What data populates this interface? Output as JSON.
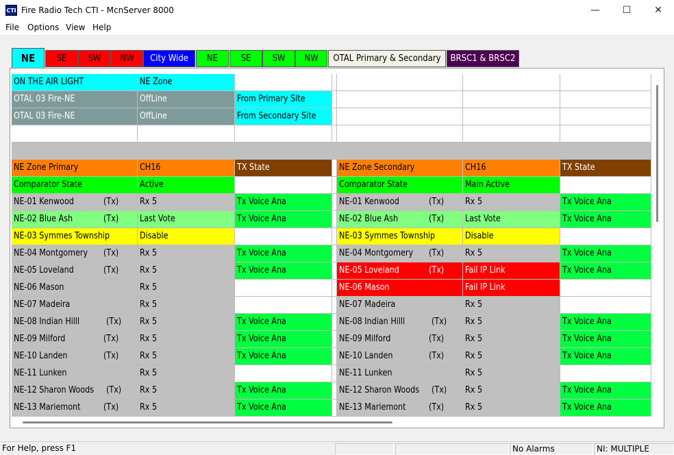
{
  "window": {
    "title": "Fire Radio Tech CTI - McnServer 8000",
    "icon_text": "CTI",
    "controls": {
      "minimize": "—",
      "maximize": "☐",
      "close": "✕"
    }
  },
  "menu": [
    "File",
    "Options",
    "View",
    "Help"
  ],
  "tabs": [
    {
      "label": "NE",
      "bg": "#00ffff",
      "fg": "#000000",
      "active": true
    },
    {
      "label": "SE",
      "bg": "#ff0000",
      "fg": "#000000"
    },
    {
      "label": "SW",
      "bg": "#ff0000",
      "fg": "#000000"
    },
    {
      "label": "NW",
      "bg": "#ff0000",
      "fg": "#000000"
    },
    {
      "label": "City Wide",
      "bg": "#0000ff",
      "fg": "#ffffff"
    },
    {
      "label": "NE",
      "bg": "#00ff00",
      "fg": "#000000"
    },
    {
      "label": "SE",
      "bg": "#00ff00",
      "fg": "#000000"
    },
    {
      "label": "SW",
      "bg": "#00ff00",
      "fg": "#000000"
    },
    {
      "label": "NW",
      "bg": "#00ff00",
      "fg": "#000000"
    },
    {
      "label": "OTAL Primary & Secondary",
      "bg": "#f2f2e6",
      "fg": "#000000"
    },
    {
      "label": "BRSC1 & BRSC2",
      "bg": "#4c0050",
      "fg": "#ffffff"
    }
  ],
  "colors": {
    "cyan": "#00ffff",
    "gray_teal": "#7f9a9a",
    "gray": "#c0c0c0",
    "orange": "#ff8000",
    "brown": "#7f4000",
    "green": "#00ff40",
    "light_green": "#80ff80",
    "yellow": "#ffff00",
    "red": "#ff0000",
    "white": "#ffffff"
  },
  "top_rows": [
    [
      {
        "text": "ON THE AIR LIGHT",
        "bg": "#00ffff"
      },
      {
        "text": "NE Zone",
        "bg": "#00ffff"
      },
      {
        "text": "",
        "bg": "#ffffff"
      }
    ],
    [
      {
        "text": "OTAL 03 Fire-NE",
        "bg": "#7f9a9a",
        "fg": "#ffffff"
      },
      {
        "text": "OffLine",
        "bg": "#7f9a9a",
        "fg": "#ffffff"
      },
      {
        "text": "From Primary Site",
        "bg": "#00ffff"
      }
    ],
    [
      {
        "text": "OTAL 03 Fire-NE",
        "bg": "#7f9a9a",
        "fg": "#ffffff"
      },
      {
        "text": "OffLine",
        "bg": "#7f9a9a",
        "fg": "#ffffff"
      },
      {
        "text": "From Secondary Site",
        "bg": "#00ffff"
      }
    ],
    [
      {
        "text": "",
        "bg": "#ffffff"
      },
      {
        "text": "",
        "bg": "#ffffff"
      },
      {
        "text": "",
        "bg": "#ffffff"
      }
    ]
  ],
  "primary": {
    "header": [
      {
        "text": "NE Zone Primary",
        "bg": "#ff8000"
      },
      {
        "text": "CH16",
        "bg": "#ff8000"
      },
      {
        "text": "TX State",
        "bg": "#7f4000",
        "fg": "#ffffff"
      }
    ],
    "comparator": [
      {
        "text": "Comparator State",
        "bg": "#00ff00"
      },
      {
        "text": "Active",
        "bg": "#00ff00"
      },
      {
        "text": "",
        "bg": "#ffffff"
      }
    ],
    "rows": [
      {
        "site": "NE-01 Kenwood",
        "tx": "(Tx)",
        "status": "Rx 5",
        "state": "Tx Voice Ana",
        "row_bg": "#c0c0c0",
        "state_bg": "#00ff40"
      },
      {
        "site": "NE-02 Blue Ash",
        "tx": "(Tx)",
        "status": "Last Vote",
        "state": "Tx Voice Ana",
        "row_bg": "#80ff80",
        "state_bg": "#00ff40"
      },
      {
        "site": "NE-03 Symmes Township",
        "tx": "",
        "status": "Disable",
        "state": "",
        "row_bg": "#ffff00",
        "state_bg": "#ffffff"
      },
      {
        "site": "NE-04 Montgomery",
        "tx": "(Tx)",
        "status": "Rx 5",
        "state": "Tx Voice Ana",
        "row_bg": "#c0c0c0",
        "state_bg": "#00ff40"
      },
      {
        "site": "NE-05 Loveland",
        "tx": "(Tx)",
        "status": "Rx 5",
        "state": "Tx Voice Ana",
        "row_bg": "#c0c0c0",
        "state_bg": "#00ff40"
      },
      {
        "site": "NE-06 Mason",
        "tx": "",
        "status": "Rx 5",
        "state": "",
        "row_bg": "#c0c0c0",
        "state_bg": "#ffffff"
      },
      {
        "site": "NE-07 Madeira",
        "tx": "",
        "status": "Rx 5",
        "state": "",
        "row_bg": "#c0c0c0",
        "state_bg": "#ffffff"
      },
      {
        "site": "NE-08 Indian Hilll",
        "tx": "(Tx)",
        "status": "Rx 5",
        "state": "Tx Voice Ana",
        "row_bg": "#c0c0c0",
        "state_bg": "#00ff40"
      },
      {
        "site": "NE-09 Milford",
        "tx": "(Tx)",
        "status": "Rx 5",
        "state": "Tx Voice Ana",
        "row_bg": "#c0c0c0",
        "state_bg": "#00ff40"
      },
      {
        "site": "NE-10 Landen",
        "tx": "(Tx)",
        "status": "Rx 5",
        "state": "Tx Voice Ana",
        "row_bg": "#c0c0c0",
        "state_bg": "#00ff40"
      },
      {
        "site": "NE-11 Lunken",
        "tx": "",
        "status": "Rx 5",
        "state": "",
        "row_bg": "#c0c0c0",
        "state_bg": "#ffffff"
      },
      {
        "site": "NE-12 Sharon Woods",
        "tx": "(Tx)",
        "status": "Rx 5",
        "state": "Tx Voice Ana",
        "row_bg": "#c0c0c0",
        "state_bg": "#00ff40"
      },
      {
        "site": "NE-13 Mariemont",
        "tx": "(Tx)",
        "status": "Rx 5",
        "state": "Tx Voice Ana",
        "row_bg": "#c0c0c0",
        "state_bg": "#00ff40"
      }
    ]
  },
  "secondary": {
    "header": [
      {
        "text": "NE Zone Secondary",
        "bg": "#ff8000"
      },
      {
        "text": "CH16",
        "bg": "#ff8000"
      },
      {
        "text": "TX State",
        "bg": "#7f4000",
        "fg": "#ffffff"
      }
    ],
    "comparator": [
      {
        "text": "Comparator State",
        "bg": "#00ff00"
      },
      {
        "text": "Main Active",
        "bg": "#00ff00"
      },
      {
        "text": "",
        "bg": "#ffffff"
      }
    ],
    "rows": [
      {
        "site": "NE-01 Kenwood",
        "tx": "(Tx)",
        "status": "Rx 5",
        "state": "Tx Voice Ana",
        "row_bg": "#c0c0c0",
        "state_bg": "#00ff40"
      },
      {
        "site": "NE-02 Blue Ash",
        "tx": "(Tx)",
        "status": "Last Vote",
        "state": "Tx Voice Ana",
        "row_bg": "#80ff80",
        "state_bg": "#00ff40"
      },
      {
        "site": "NE-03 Symmes Township",
        "tx": "",
        "status": "Disable",
        "state": "",
        "row_bg": "#ffff00",
        "state_bg": "#ffffff"
      },
      {
        "site": "NE-04 Montgomery",
        "tx": "(Tx)",
        "status": "Rx 5",
        "state": "Tx Voice Ana",
        "row_bg": "#c0c0c0",
        "state_bg": "#00ff40"
      },
      {
        "site": "NE-05 Loveland",
        "tx": "(Tx)",
        "status": "Fail IP Link",
        "state": "Tx Voice Ana",
        "row_bg": "#ff0000",
        "row_fg": "#ffffff",
        "state_bg": "#00ff40"
      },
      {
        "site": "NE-06 Mason",
        "tx": "",
        "status": "Fail IP Link",
        "state": "",
        "row_bg": "#ff0000",
        "row_fg": "#ffffff",
        "state_bg": "#ffffff"
      },
      {
        "site": "NE-07 Madeira",
        "tx": "",
        "status": "Rx 5",
        "state": "",
        "row_bg": "#c0c0c0",
        "state_bg": "#ffffff"
      },
      {
        "site": "NE-08 Indian Hilll",
        "tx": "(Tx)",
        "status": "Rx 5",
        "state": "Tx Voice Ana",
        "row_bg": "#c0c0c0",
        "state_bg": "#00ff40"
      },
      {
        "site": "NE-09 Milford",
        "tx": "(Tx)",
        "status": "Rx 5",
        "state": "Tx Voice Ana",
        "row_bg": "#c0c0c0",
        "state_bg": "#00ff40"
      },
      {
        "site": "NE-10 Landen",
        "tx": "(Tx)",
        "status": "Rx 5",
        "state": "Tx Voice Ana",
        "row_bg": "#c0c0c0",
        "state_bg": "#00ff40"
      },
      {
        "site": "NE-11 Lunken",
        "tx": "",
        "status": "Rx 5",
        "state": "",
        "row_bg": "#c0c0c0",
        "state_bg": "#ffffff"
      },
      {
        "site": "NE-12 Sharon Woods",
        "tx": "(Tx)",
        "status": "Rx 5",
        "state": "Tx Voice Ana",
        "row_bg": "#c0c0c0",
        "state_bg": "#00ff40"
      },
      {
        "site": "NE-13 Mariemont",
        "tx": "(Tx)",
        "status": "Rx 5",
        "state": "Tx Voice Ana",
        "row_bg": "#c0c0c0",
        "state_bg": "#00ff40"
      }
    ]
  },
  "status_bar": {
    "help": "For Help, press F1",
    "alarms": "No Alarms",
    "ni": "NI: MULTIPLE"
  }
}
